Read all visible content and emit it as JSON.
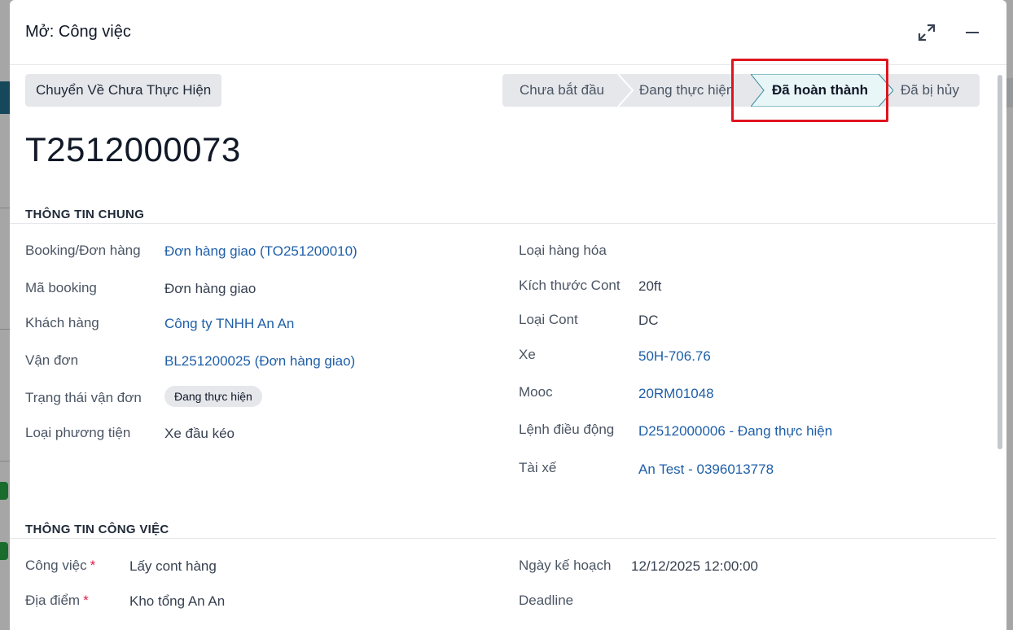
{
  "modal": {
    "title": "Mở: Công việc"
  },
  "header_icons": {
    "expand": "expand-icon",
    "minimize": "minimize-icon"
  },
  "actions": {
    "back_button": "Chuyển Về Chưa Thực Hiện"
  },
  "stages": [
    {
      "label": "Chưa bắt đầu",
      "active": false
    },
    {
      "label": "Đang thực hiện",
      "active": false
    },
    {
      "label": "Đã hoàn thành",
      "active": true
    },
    {
      "label": "Đã bị hủy",
      "active": false
    }
  ],
  "record": {
    "name": "T2512000073"
  },
  "general": {
    "section_title": "THÔNG TIN CHUNG",
    "booking_label": "Booking/Đơn hàng",
    "booking_value": "Đơn hàng giao (TO251200010)",
    "booking_code_label": "Mã booking",
    "booking_code_value": "Đơn hàng giao",
    "customer_label": "Khách hàng",
    "customer_value": "Công ty TNHH An An",
    "bill_label": "Vận đơn",
    "bill_value": "BL251200025 (Đơn hàng giao)",
    "bill_status_label": "Trạng thái vận đơn",
    "bill_status_value": "Đang thực hiện",
    "vehicle_type_label": "Loại phương tiện",
    "vehicle_type_value": "Xe đầu kéo",
    "goods_type_label": "Loại hàng hóa",
    "goods_type_value": "",
    "cont_size_label": "Kích thước Cont",
    "cont_size_value": "20ft",
    "cont_type_label": "Loại Cont",
    "cont_type_value": "DC",
    "truck_label": "Xe",
    "truck_value": "50H-706.76",
    "trailer_label": "Mooc",
    "trailer_value": "20RM01048",
    "dispatch_label": "Lệnh điều động",
    "dispatch_value": "D2512000006 - Đang thực hiện",
    "driver_label": "Tài xế",
    "driver_value": "An Test - 0396013778"
  },
  "work": {
    "section_title": "THÔNG TIN CÔNG VIỆC",
    "task_label": "Công việc",
    "task_value": "Lấy cont hàng",
    "location_label": "Địa điểm",
    "location_value": "Kho tổng An An",
    "plan_date_label": "Ngày kế hoạch",
    "plan_date_value": "12/12/2025 12:00:00",
    "deadline_label": "Deadline",
    "deadline_value": "",
    "required_mark": "*"
  },
  "colors": {
    "link": "#1f5fa8",
    "highlight": "#e0141e",
    "active_stage_bg": "#e8f6f8",
    "active_stage_border": "#2e8a9a"
  }
}
